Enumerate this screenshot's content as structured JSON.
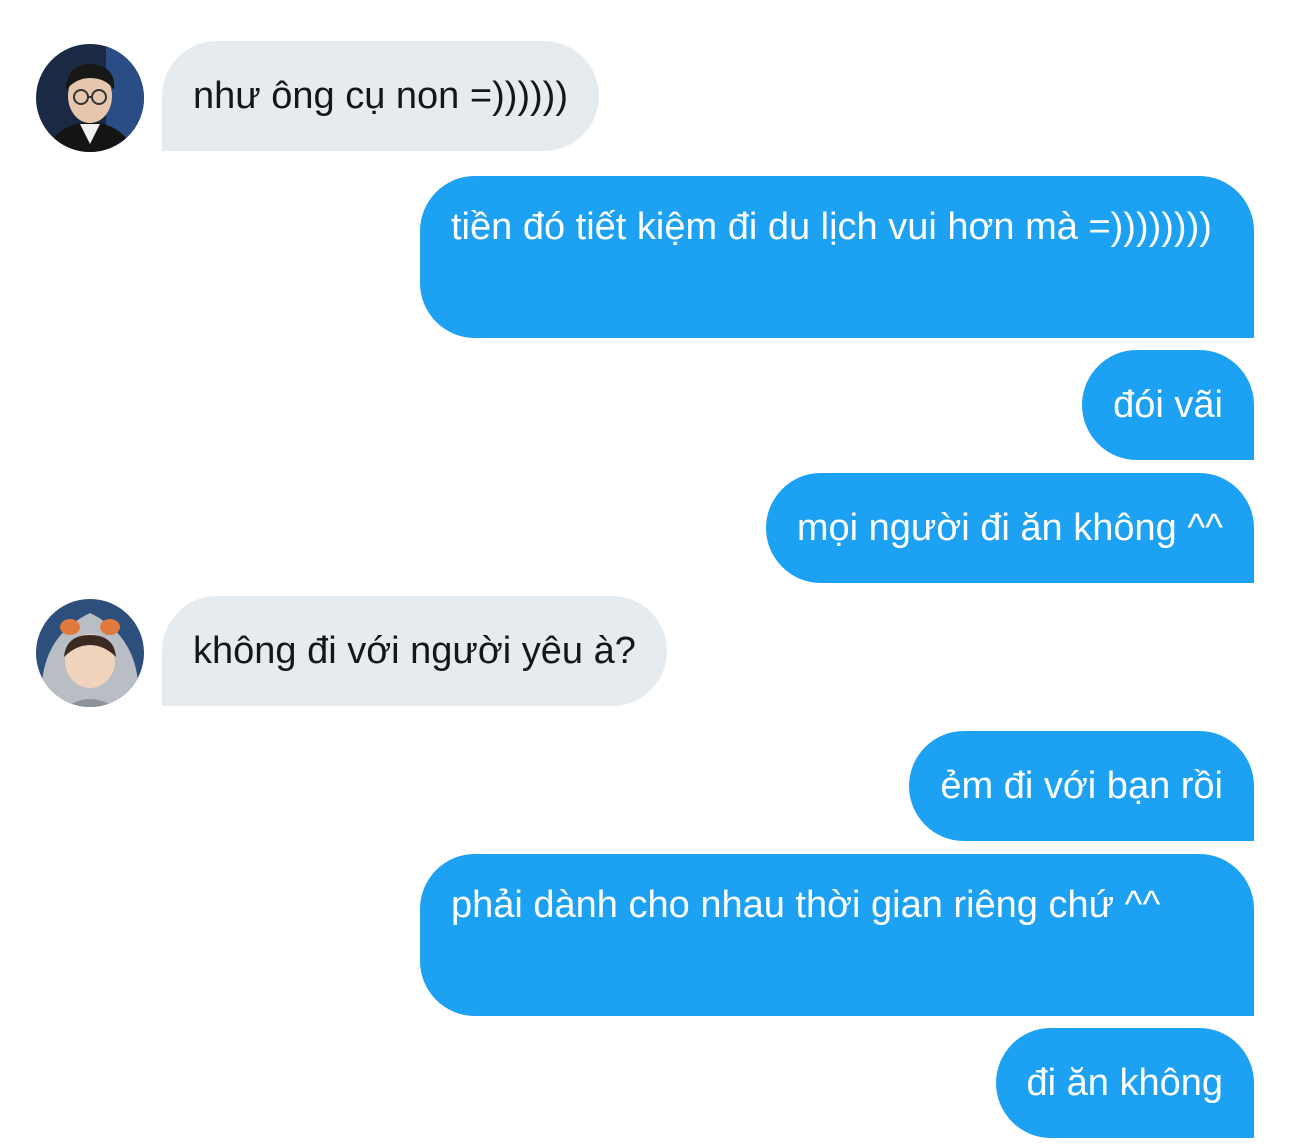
{
  "colors": {
    "incoming_bubble": "#e6ebef",
    "outgoing_bubble": "#1da1f2",
    "incoming_text": "#14171a",
    "outgoing_text": "#ffffff"
  },
  "messages": [
    {
      "direction": "incoming",
      "avatar": "avatar-glasses",
      "text": "như ông cụ non =))))))"
    },
    {
      "direction": "outgoing",
      "text": "tiền đó tiết kiệm đi du lịch vui hơn mà =))))))))"
    },
    {
      "direction": "outgoing",
      "text": "đói vãi"
    },
    {
      "direction": "outgoing",
      "text": "mọi người đi ăn không ^^"
    },
    {
      "direction": "incoming",
      "avatar": "avatar-hood",
      "text": "không đi với người yêu à?"
    },
    {
      "direction": "outgoing",
      "text": "ẻm đi với bạn rồi"
    },
    {
      "direction": "outgoing",
      "text": "phải dành cho nhau thời gian riêng chứ ^^"
    },
    {
      "direction": "outgoing",
      "text": "đi ăn không"
    }
  ]
}
